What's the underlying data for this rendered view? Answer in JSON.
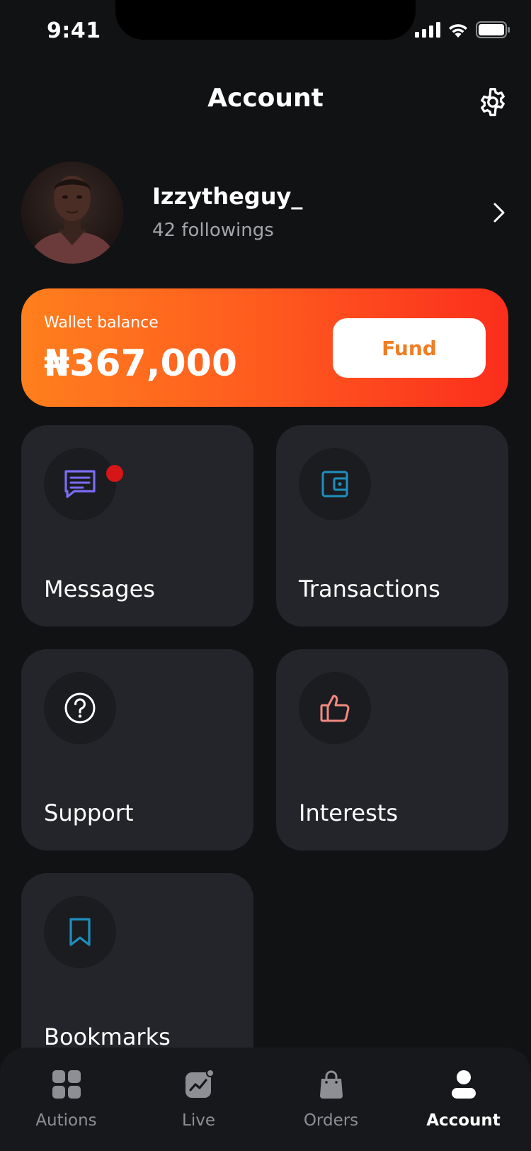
{
  "status_bar": {
    "time": "9:41"
  },
  "header": {
    "title": "Account"
  },
  "profile": {
    "username": "Izzytheguy_",
    "followings": "42 followings"
  },
  "wallet": {
    "label": "Wallet balance",
    "amount": "₦367,000",
    "fund_label": "Fund"
  },
  "tiles": [
    {
      "label": "Messages",
      "icon": "message-icon",
      "has_notification": true,
      "icon_color": "#7b6cf6"
    },
    {
      "label": "Transactions",
      "icon": "wallet-icon",
      "icon_color": "#1f8fbe"
    },
    {
      "label": "Support",
      "icon": "help-icon",
      "icon_color": "#ffffff"
    },
    {
      "label": "Interests",
      "icon": "thumbs-up-icon",
      "icon_color": "#f08a80"
    },
    {
      "label": "Bookmarks",
      "icon": "bookmark-icon",
      "icon_color": "#1f8fbe"
    }
  ],
  "tabbar": {
    "tabs": [
      {
        "label": "Autions",
        "icon": "grid-icon",
        "active": false
      },
      {
        "label": "Live",
        "icon": "live-chart-icon",
        "active": false
      },
      {
        "label": "Orders",
        "icon": "shopping-bag-icon",
        "active": false
      },
      {
        "label": "Account",
        "icon": "person-icon",
        "active": true
      }
    ]
  },
  "colors": {
    "accent": "#ff6a1f",
    "background": "#111214",
    "tile": "#24252a",
    "fund_text": "#f07d22"
  }
}
